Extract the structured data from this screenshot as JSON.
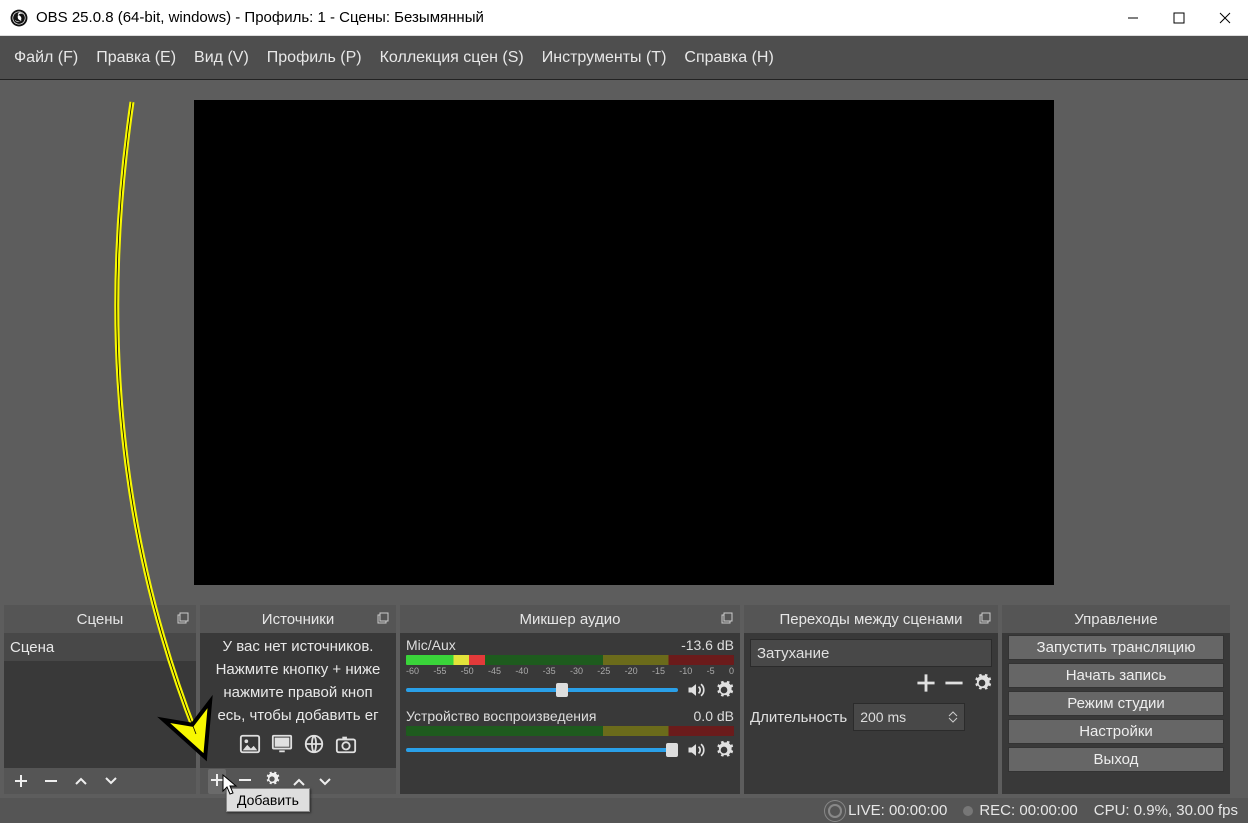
{
  "title": "OBS 25.0.8 (64-bit, windows) - Профиль: 1 - Сцены: Безымянный",
  "menu": {
    "file": "Файл (F)",
    "edit": "Правка (E)",
    "view": "Вид (V)",
    "profile": "Профиль (P)",
    "scene_collection": "Коллекция сцен (S)",
    "tools": "Инструменты (T)",
    "help": "Справка (H)"
  },
  "scenes": {
    "title": "Сцены",
    "items": [
      "Сцена"
    ]
  },
  "sources": {
    "title": "Источники",
    "hint1": "У вас нет источников.",
    "hint2": "Нажмите кнопку + ниже",
    "hint3": "нажмите правой кноп",
    "hint4": "есь, чтобы добавить ег"
  },
  "mixer": {
    "title": "Микшер аудио",
    "ch1_name": "Mic/Aux",
    "ch1_db": "-13.6 dB",
    "ch2_name": "Устройство воспроизведения",
    "ch2_db": "0.0 dB",
    "ticks": [
      "-60",
      "-55",
      "-50",
      "-45",
      "-40",
      "-35",
      "-30",
      "-25",
      "-20",
      "-15",
      "-10",
      "-5",
      "0"
    ]
  },
  "transitions": {
    "title": "Переходы между сценами",
    "selected": "Затухание",
    "duration_label": "Длительность",
    "duration_value": "200 ms"
  },
  "controls": {
    "title": "Управление",
    "start_stream": "Запустить трансляцию",
    "start_record": "Начать запись",
    "studio_mode": "Режим студии",
    "settings": "Настройки",
    "exit": "Выход"
  },
  "status": {
    "live": "LIVE: 00:00:00",
    "rec": "REC: 00:00:00",
    "cpu": "CPU: 0.9%, 30.00 fps"
  },
  "tooltip": "Добавить"
}
